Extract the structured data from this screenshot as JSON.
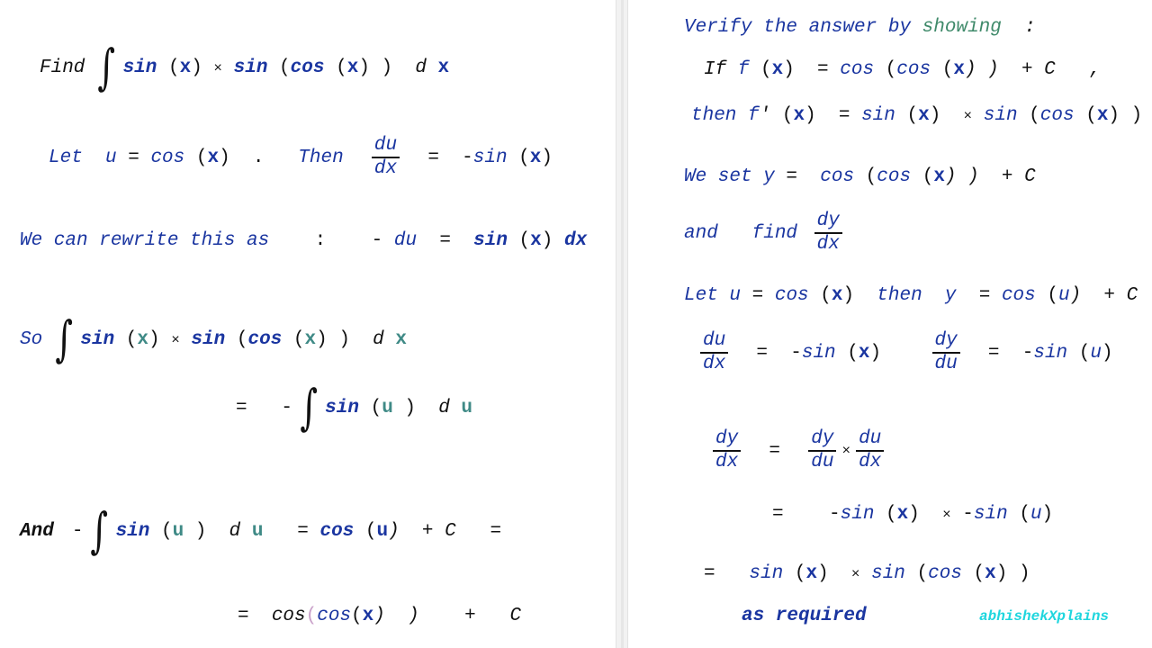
{
  "left": {
    "find_line": {
      "label": "Find",
      "integral": "∫",
      "tokens": [
        {
          "t": "sin",
          "c": "bb"
        },
        {
          "t": " (",
          "c": "p"
        },
        {
          "t": "x",
          "c": "v"
        },
        {
          "t": ") ",
          "c": "p"
        },
        {
          "t": "×",
          "c": "op"
        },
        {
          "t": " sin",
          "c": "bb"
        },
        {
          "t": " (",
          "c": "p"
        },
        {
          "t": "cos",
          "c": "bb"
        },
        {
          "t": " (",
          "c": "p"
        },
        {
          "t": "x",
          "c": "v"
        },
        {
          "t": ") )  ",
          "c": "p"
        },
        {
          "t": "d",
          "c": "k"
        },
        {
          "t": " x",
          "c": "v"
        }
      ]
    },
    "let_line": {
      "tokens": [
        {
          "t": "Let  ",
          "c": "b"
        },
        {
          "t": "u",
          "c": "b"
        },
        {
          "t": " = ",
          "c": "p"
        },
        {
          "t": "cos",
          "c": "b"
        },
        {
          "t": " (",
          "c": "p"
        },
        {
          "t": "x",
          "c": "v"
        },
        {
          "t": ")  .   ",
          "c": "p"
        },
        {
          "t": "Then  ",
          "c": "b"
        }
      ],
      "frac": {
        "num": "du",
        "den": "dx"
      },
      "tail": [
        {
          "t": "  =  ",
          "c": "p"
        },
        {
          "t": "-",
          "c": "p"
        },
        {
          "t": "sin",
          "c": "b"
        },
        {
          "t": " (",
          "c": "p"
        },
        {
          "t": "x",
          "c": "v"
        },
        {
          "t": ")",
          "c": "p"
        }
      ]
    },
    "rewrite_line": {
      "tokens": [
        {
          "t": "We can rewrite this as",
          "c": "b"
        },
        {
          "t": "    :    ",
          "c": "p"
        },
        {
          "t": "- ",
          "c": "p"
        },
        {
          "t": "du",
          "c": "b"
        },
        {
          "t": "  =  ",
          "c": "p"
        },
        {
          "t": "sin",
          "c": "bb"
        },
        {
          "t": " (",
          "c": "p"
        },
        {
          "t": "x",
          "c": "v"
        },
        {
          "t": ") ",
          "c": "p"
        },
        {
          "t": "dx",
          "c": "bb"
        }
      ]
    },
    "so_line": {
      "label": "So",
      "integral": "∫",
      "tokens": [
        {
          "t": "sin",
          "c": "bb"
        },
        {
          "t": " (",
          "c": "p"
        },
        {
          "t": "x",
          "c": "tl"
        },
        {
          "t": ") ",
          "c": "p"
        },
        {
          "t": "×",
          "c": "op"
        },
        {
          "t": " sin",
          "c": "bb"
        },
        {
          "t": " (",
          "c": "p"
        },
        {
          "t": "cos",
          "c": "bb"
        },
        {
          "t": " (",
          "c": "p"
        },
        {
          "t": "x",
          "c": "tl"
        },
        {
          "t": ") )  ",
          "c": "p"
        },
        {
          "t": "d",
          "c": "k"
        },
        {
          "t": " x",
          "c": "tl"
        }
      ]
    },
    "eq_line": {
      "prefix": "=   -",
      "integral": "∫",
      "tokens": [
        {
          "t": "sin",
          "c": "bb"
        },
        {
          "t": " (",
          "c": "p"
        },
        {
          "t": "u",
          "c": "tl"
        },
        {
          "t": " )  ",
          "c": "p"
        },
        {
          "t": "d",
          "c": "k"
        },
        {
          "t": " u",
          "c": "tl"
        }
      ]
    },
    "and_line": {
      "label": "And",
      "prefix": "-",
      "integral": "∫",
      "tokens": [
        {
          "t": "sin",
          "c": "bb"
        },
        {
          "t": " (",
          "c": "p"
        },
        {
          "t": "u",
          "c": "tl"
        },
        {
          "t": " )  ",
          "c": "p"
        },
        {
          "t": "d",
          "c": "k"
        },
        {
          "t": " u",
          "c": "tl"
        },
        {
          "t": "   = ",
          "c": "p"
        },
        {
          "t": "cos",
          "c": "bb"
        },
        {
          "t": " (",
          "c": "p"
        },
        {
          "t": "u",
          "c": "v"
        },
        {
          "t": ")  + C   =",
          "c": "k"
        }
      ]
    },
    "result_line": {
      "tokens": [
        {
          "t": "=  ",
          "c": "p"
        },
        {
          "t": "cos",
          "c": "k"
        },
        {
          "t": "(",
          "c": "pk"
        },
        {
          "t": "cos",
          "c": "b"
        },
        {
          "t": "(",
          "c": "p"
        },
        {
          "t": "x",
          "c": "v"
        },
        {
          "t": ")  )    +   C",
          "c": "k"
        }
      ]
    }
  },
  "right": {
    "verify_line": {
      "tokens": [
        {
          "t": "Verify the answer by ",
          "c": "b"
        },
        {
          "t": "showing",
          "c": "g"
        },
        {
          "t": "  :",
          "c": "k"
        }
      ]
    },
    "if_line": {
      "tokens": [
        {
          "t": "If ",
          "c": "k"
        },
        {
          "t": "f",
          "c": "b"
        },
        {
          "t": " (",
          "c": "p"
        },
        {
          "t": "x",
          "c": "v"
        },
        {
          "t": ")  = ",
          "c": "p"
        },
        {
          "t": "cos",
          "c": "b"
        },
        {
          "t": " (",
          "c": "p"
        },
        {
          "t": "cos",
          "c": "b"
        },
        {
          "t": " (",
          "c": "p"
        },
        {
          "t": "x",
          "c": "v"
        },
        {
          "t": ") )  + C   ,",
          "c": "k"
        }
      ]
    },
    "then_line": {
      "tokens": [
        {
          "t": "then ",
          "c": "b"
        },
        {
          "t": "f",
          "c": "b"
        },
        {
          "t": "'",
          "c": "k"
        },
        {
          "t": " (",
          "c": "p"
        },
        {
          "t": "x",
          "c": "v"
        },
        {
          "t": ")  = ",
          "c": "p"
        },
        {
          "t": "sin",
          "c": "b"
        },
        {
          "t": " (",
          "c": "p"
        },
        {
          "t": "x",
          "c": "v"
        },
        {
          "t": ")  ",
          "c": "p"
        },
        {
          "t": "×",
          "c": "op"
        },
        {
          "t": " sin",
          "c": "b"
        },
        {
          "t": " (",
          "c": "p"
        },
        {
          "t": "cos",
          "c": "b"
        },
        {
          "t": " (",
          "c": "p"
        },
        {
          "t": "x",
          "c": "v"
        },
        {
          "t": ") )",
          "c": "p"
        }
      ]
    },
    "set_line": {
      "tokens": [
        {
          "t": "We set ",
          "c": "b"
        },
        {
          "t": "y",
          "c": "b"
        },
        {
          "t": " =  ",
          "c": "p"
        },
        {
          "t": "cos",
          "c": "b"
        },
        {
          "t": " (",
          "c": "p"
        },
        {
          "t": "cos",
          "c": "b"
        },
        {
          "t": " (",
          "c": "p"
        },
        {
          "t": "x",
          "c": "v"
        },
        {
          "t": ") )  + C",
          "c": "k"
        }
      ]
    },
    "and_find_line": {
      "tokens": [
        {
          "t": "and   find ",
          "c": "b"
        }
      ],
      "frac": {
        "num": "dy",
        "den": "dx"
      }
    },
    "let_line": {
      "tokens": [
        {
          "t": "Let ",
          "c": "b"
        },
        {
          "t": "u",
          "c": "b"
        },
        {
          "t": " = ",
          "c": "p"
        },
        {
          "t": "cos",
          "c": "b"
        },
        {
          "t": " (",
          "c": "p"
        },
        {
          "t": "x",
          "c": "v"
        },
        {
          "t": ")  ",
          "c": "p"
        },
        {
          "t": "then  y",
          "c": "b"
        },
        {
          "t": "  = ",
          "c": "p"
        },
        {
          "t": "cos",
          "c": "b"
        },
        {
          "t": " (",
          "c": "p"
        },
        {
          "t": "u",
          "c": "b"
        },
        {
          "t": ")  + C",
          "c": "k"
        }
      ]
    },
    "deriv_line": {
      "frac1": {
        "num": "du",
        "den": "dx"
      },
      "mid": [
        {
          "t": "  =  -",
          "c": "p"
        },
        {
          "t": "sin",
          "c": "b"
        },
        {
          "t": " (",
          "c": "p"
        },
        {
          "t": "x",
          "c": "v"
        },
        {
          "t": ")    ",
          "c": "p"
        }
      ],
      "frac2": {
        "num": "dy",
        "den": "du"
      },
      "tail": [
        {
          "t": "  =  -",
          "c": "p"
        },
        {
          "t": "sin",
          "c": "b"
        },
        {
          "t": " (",
          "c": "p"
        },
        {
          "t": "u",
          "c": "b"
        },
        {
          "t": ")",
          "c": "p"
        }
      ]
    },
    "chain_line": {
      "frac1": {
        "num": "dy",
        "den": "dx"
      },
      "eq": "  =  ",
      "frac2": {
        "num": "dy",
        "den": "du"
      },
      "times": "×",
      "frac3": {
        "num": "du",
        "den": "dx"
      }
    },
    "product_line": {
      "tokens": [
        {
          "t": "=    -",
          "c": "p"
        },
        {
          "t": "sin",
          "c": "b"
        },
        {
          "t": " (",
          "c": "p"
        },
        {
          "t": "x",
          "c": "v"
        },
        {
          "t": ")  ",
          "c": "p"
        },
        {
          "t": "×",
          "c": "op"
        },
        {
          "t": " -",
          "c": "p"
        },
        {
          "t": "sin",
          "c": "b"
        },
        {
          "t": " (",
          "c": "p"
        },
        {
          "t": "u",
          "c": "b"
        },
        {
          "t": ")",
          "c": "p"
        }
      ]
    },
    "final_line": {
      "tokens": [
        {
          "t": "=   ",
          "c": "p"
        },
        {
          "t": "sin",
          "c": "b"
        },
        {
          "t": " (",
          "c": "p"
        },
        {
          "t": "x",
          "c": "v"
        },
        {
          "t": ")  ",
          "c": "p"
        },
        {
          "t": "×",
          "c": "op"
        },
        {
          "t": " sin",
          "c": "b"
        },
        {
          "t": " (",
          "c": "p"
        },
        {
          "t": "cos",
          "c": "b"
        },
        {
          "t": " (",
          "c": "p"
        },
        {
          "t": "x",
          "c": "v"
        },
        {
          "t": ") )",
          "c": "p"
        }
      ]
    },
    "as_required": "as required"
  },
  "watermark": "abhishekXplains",
  "colors": {
    "blue": "#1a35a0",
    "teal": "#3f8a86",
    "green": "#3f8a6a",
    "watermark": "#1fd6de",
    "pink": "#c9a0c9"
  }
}
